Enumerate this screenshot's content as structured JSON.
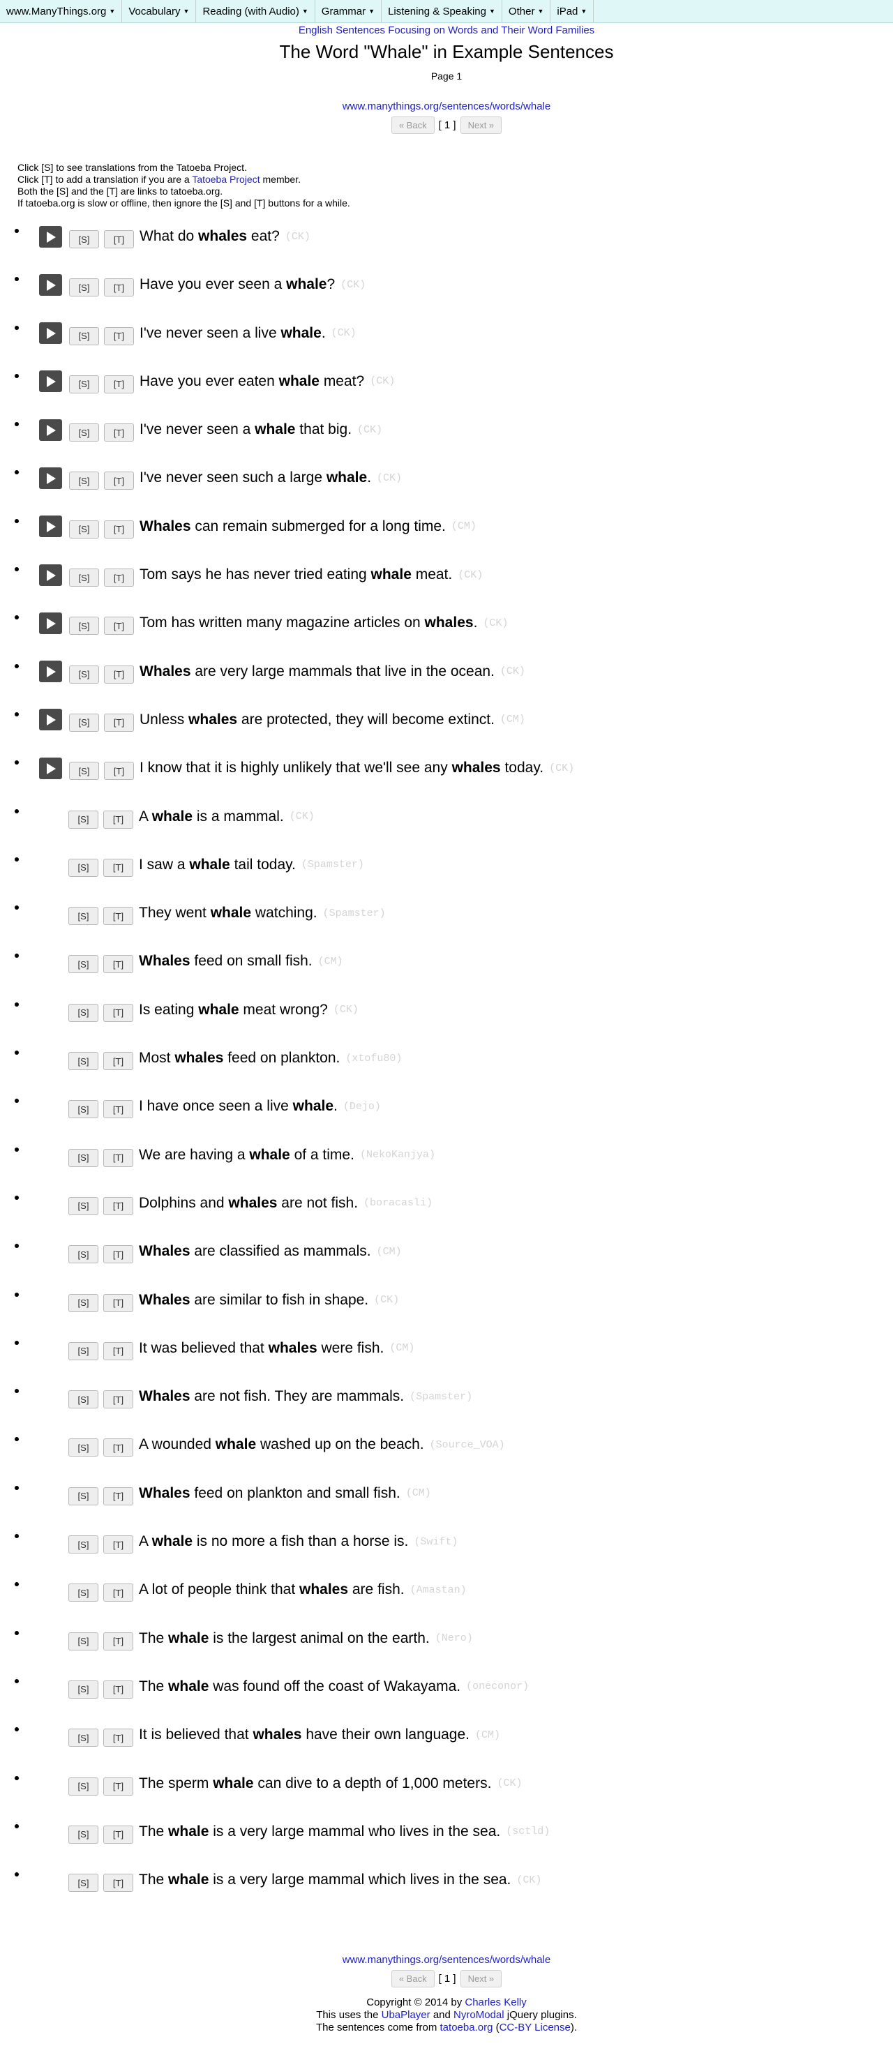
{
  "menu": [
    "www.ManyThings.org",
    "Vocabulary",
    "Reading (with Audio)",
    "Grammar",
    "Listening & Speaking",
    "Other",
    "iPad"
  ],
  "header": {
    "subtitle": "English Sentences Focusing on Words and Their Word Families",
    "title": "The Word \"Whale\" in Example Sentences",
    "page_label": "Page 1",
    "url": "www.manythings.org/sentences/words/whale"
  },
  "pager": {
    "back": "« Back",
    "current": "[ 1 ]",
    "next": "Next »"
  },
  "instructions": {
    "line1": "Click [S] to see translations from the Tatoeba Project.",
    "line2_before": "Click [T] to add a translation if you are a ",
    "line2_link": "Tatoeba Project",
    "line2_after": " member.",
    "line3": "Both the [S] and the [T] are links to tatoeba.org.",
    "line4": "If tatoeba.org is slow or offline, then ignore the [S] and [T] buttons for a while."
  },
  "buttons": {
    "s": "[S]",
    "t": "[T]"
  },
  "sentences": [
    {
      "audio": true,
      "before": "What do ",
      "word": "whales",
      "after": " eat?",
      "author": "(CK)"
    },
    {
      "audio": true,
      "before": "Have you ever seen a ",
      "word": "whale",
      "after": "?",
      "author": "(CK)"
    },
    {
      "audio": true,
      "before": "I've never seen a live ",
      "word": "whale",
      "after": ".",
      "author": "(CK)"
    },
    {
      "audio": true,
      "before": "Have you ever eaten ",
      "word": "whale",
      "after": " meat?",
      "author": "(CK)"
    },
    {
      "audio": true,
      "before": "I've never seen a ",
      "word": "whale",
      "after": " that big.",
      "author": "(CK)"
    },
    {
      "audio": true,
      "before": "I've never seen such a large ",
      "word": "whale",
      "after": ".",
      "author": "(CK)"
    },
    {
      "audio": true,
      "before": "",
      "word": "Whales",
      "after": " can remain submerged for a long time.",
      "author": "(CM)"
    },
    {
      "audio": true,
      "before": "Tom says he has never tried eating ",
      "word": "whale",
      "after": " meat.",
      "author": "(CK)"
    },
    {
      "audio": true,
      "before": "Tom has written many magazine articles on ",
      "word": "whales",
      "after": ".",
      "author": "(CK)"
    },
    {
      "audio": true,
      "before": "",
      "word": "Whales",
      "after": " are very large mammals that live in the ocean.",
      "author": "(CK)"
    },
    {
      "audio": true,
      "before": "Unless ",
      "word": "whales",
      "after": " are protected, they will become extinct.",
      "author": "(CM)"
    },
    {
      "audio": true,
      "before": "I know that it is highly unlikely that we'll see any ",
      "word": "whales",
      "after": " today.",
      "author": "(CK)"
    },
    {
      "audio": false,
      "before": "A ",
      "word": "whale",
      "after": " is a mammal.",
      "author": "(CK)"
    },
    {
      "audio": false,
      "before": "I saw a ",
      "word": "whale",
      "after": " tail today.",
      "author": "(Spamster)"
    },
    {
      "audio": false,
      "before": "They went ",
      "word": "whale",
      "after": " watching.",
      "author": "(Spamster)"
    },
    {
      "audio": false,
      "before": "",
      "word": "Whales",
      "after": " feed on small fish.",
      "author": "(CM)"
    },
    {
      "audio": false,
      "before": "Is eating ",
      "word": "whale",
      "after": " meat wrong?",
      "author": "(CK)"
    },
    {
      "audio": false,
      "before": "Most ",
      "word": "whales",
      "after": " feed on plankton.",
      "author": "(xtofu80)"
    },
    {
      "audio": false,
      "before": "I have once seen a live ",
      "word": "whale",
      "after": ".",
      "author": "(Dejo)"
    },
    {
      "audio": false,
      "before": "We are having a ",
      "word": "whale",
      "after": " of a time.",
      "author": "(NekoKanjya)"
    },
    {
      "audio": false,
      "before": "Dolphins and ",
      "word": "whales",
      "after": " are not fish.",
      "author": "(boracasli)"
    },
    {
      "audio": false,
      "before": "",
      "word": "Whales",
      "after": " are classified as mammals.",
      "author": "(CM)"
    },
    {
      "audio": false,
      "before": "",
      "word": "Whales",
      "after": " are similar to fish in shape.",
      "author": "(CK)"
    },
    {
      "audio": false,
      "before": "It was believed that ",
      "word": "whales",
      "after": " were fish.",
      "author": "(CM)"
    },
    {
      "audio": false,
      "before": "",
      "word": "Whales",
      "after": " are not fish. They are mammals.",
      "author": "(Spamster)"
    },
    {
      "audio": false,
      "before": "A wounded ",
      "word": "whale",
      "after": " washed up on the beach.",
      "author": "(Source_VOA)"
    },
    {
      "audio": false,
      "before": "",
      "word": "Whales",
      "after": " feed on plankton and small fish.",
      "author": "(CM)"
    },
    {
      "audio": false,
      "before": "A ",
      "word": "whale",
      "after": " is no more a fish than a horse is.",
      "author": "(Swift)"
    },
    {
      "audio": false,
      "before": "A lot of people think that ",
      "word": "whales",
      "after": " are fish.",
      "author": "(Amastan)"
    },
    {
      "audio": false,
      "before": "The ",
      "word": "whale",
      "after": " is the largest animal on the earth.",
      "author": "(Nero)"
    },
    {
      "audio": false,
      "before": "The ",
      "word": "whale",
      "after": " was found off the coast of Wakayama.",
      "author": "(oneconor)"
    },
    {
      "audio": false,
      "before": "It is believed that ",
      "word": "whales",
      "after": " have their own language.",
      "author": "(CM)"
    },
    {
      "audio": false,
      "before": "The sperm ",
      "word": "whale",
      "after": " can dive to a depth of 1,000 meters.",
      "author": "(CK)"
    },
    {
      "audio": false,
      "before": "The ",
      "word": "whale",
      "after": " is a very large mammal who lives in the sea.",
      "author": "(sctld)"
    },
    {
      "audio": false,
      "before": "The ",
      "word": "whale",
      "after": " is a very large mammal which lives in the sea.",
      "author": "(CK)"
    }
  ],
  "footer": {
    "url": "www.manythings.org/sentences/words/whale",
    "copyright_text": "Copyright © 2014 by ",
    "author_link": "Charles Kelly",
    "uses_text": "This uses the ",
    "uba_link": "UbaPlayer",
    "and_text": " and ",
    "nyro_link": "NyroModal",
    "plugins_text": " jQuery plugins.",
    "source_text": "The sentences come from ",
    "tatoeba_link": "tatoeba.org",
    "license_open": " (",
    "license_link": "CC-BY License",
    "license_close": ")."
  }
}
